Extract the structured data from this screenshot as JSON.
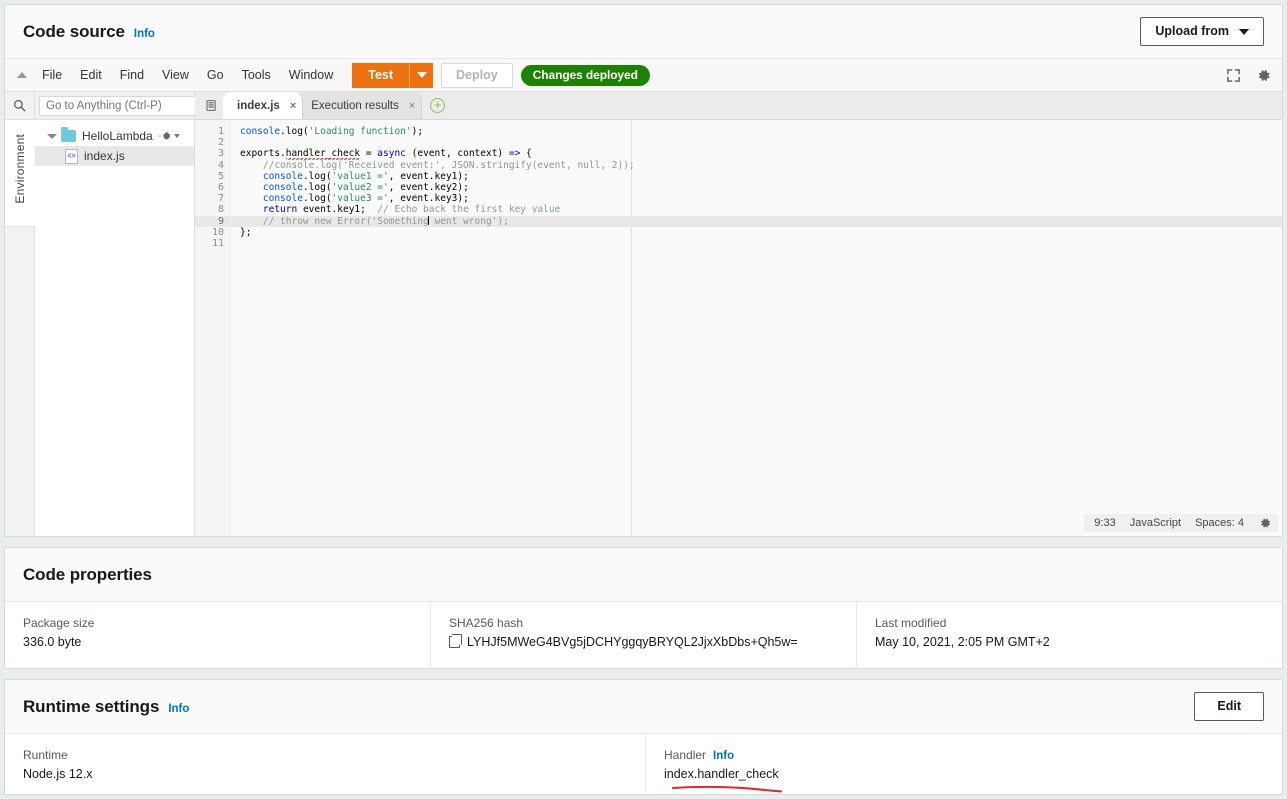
{
  "code_source": {
    "title": "Code source",
    "info_label": "Info",
    "upload_button": "Upload from"
  },
  "ide": {
    "menu": [
      "File",
      "Edit",
      "Find",
      "View",
      "Go",
      "Tools",
      "Window"
    ],
    "test_button": "Test",
    "deploy_button": "Deploy",
    "deployed_badge": "Changes deployed",
    "goto_placeholder": "Go to Anything (Ctrl-P)",
    "environment_label": "Environment",
    "tree": {
      "folder_name": "HelloLambda",
      "folder_path": "- /",
      "file_name": "index.js"
    },
    "tabs": [
      {
        "label": "index.js",
        "close": "×",
        "active": true
      },
      {
        "label": "Execution results",
        "close": "×",
        "active": false
      }
    ],
    "add_tab": "+",
    "status": {
      "cursor": "9:33",
      "language": "JavaScript",
      "indent": "Spaces: 4"
    },
    "line_numbers": [
      "1",
      "2",
      "3",
      "4",
      "5",
      "6",
      "7",
      "8",
      "9",
      "10",
      "11"
    ],
    "current_line": 9,
    "code_lines": [
      [
        {
          "t": "console",
          "c": "tok-fn"
        },
        {
          "t": ".log(",
          "c": ""
        },
        {
          "t": "'Loading function'",
          "c": "tok-str"
        },
        {
          "t": ");",
          "c": ""
        }
      ],
      [],
      [
        {
          "t": "exports.",
          "c": ""
        },
        {
          "t": "handler_check",
          "c": "squig"
        },
        {
          "t": " = ",
          "c": ""
        },
        {
          "t": "async",
          "c": "tok-kw"
        },
        {
          "t": " (event, context) ",
          "c": ""
        },
        {
          "t": "=>",
          "c": "tok-kw"
        },
        {
          "t": " {",
          "c": ""
        }
      ],
      [
        {
          "t": "    //console.log('Received event:', JSON.stringify(event, null, 2));",
          "c": "tok-com"
        }
      ],
      [
        {
          "t": "    ",
          "c": ""
        },
        {
          "t": "console",
          "c": "tok-fn"
        },
        {
          "t": ".log(",
          "c": ""
        },
        {
          "t": "'value1 ='",
          "c": "tok-str"
        },
        {
          "t": ", event.key1);",
          "c": ""
        }
      ],
      [
        {
          "t": "    ",
          "c": ""
        },
        {
          "t": "console",
          "c": "tok-fn"
        },
        {
          "t": ".log(",
          "c": ""
        },
        {
          "t": "'value2 ='",
          "c": "tok-str"
        },
        {
          "t": ", event.key2);",
          "c": ""
        }
      ],
      [
        {
          "t": "    ",
          "c": ""
        },
        {
          "t": "console",
          "c": "tok-fn"
        },
        {
          "t": ".log(",
          "c": ""
        },
        {
          "t": "'value3 ='",
          "c": "tok-str"
        },
        {
          "t": ", event.key3);",
          "c": ""
        }
      ],
      [
        {
          "t": "    ",
          "c": ""
        },
        {
          "t": "return",
          "c": "tok-kw"
        },
        {
          "t": " event.key1;  ",
          "c": ""
        },
        {
          "t": "// Echo back the first key value",
          "c": "tok-com"
        }
      ],
      [
        {
          "t": "    ",
          "c": ""
        },
        {
          "t": "// throw new Error('Something",
          "c": "tok-com"
        },
        {
          "t": "|CARET|",
          "c": ""
        },
        {
          "t": " went wrong');",
          "c": "tok-com"
        }
      ],
      [
        {
          "t": "};",
          "c": ""
        }
      ],
      []
    ],
    "code_plain": [
      "console.log('Loading function');",
      "",
      "exports.handler_check = async (event, context) => {",
      "    //console.log('Received event:', JSON.stringify(event, null, 2));",
      "    console.log('value1 =', event.key1);",
      "    console.log('value2 =', event.key2);",
      "    console.log('value3 =', event.key3);",
      "    return event.key1;  // Echo back the first key value",
      "    // throw new Error('Something went wrong');",
      "};",
      ""
    ]
  },
  "code_properties": {
    "title": "Code properties",
    "fields": [
      {
        "label": "Package size",
        "value": "336.0 byte"
      },
      {
        "label": "SHA256 hash",
        "value": "LYHJf5MWeG4BVg5jDCHYggqyBRYQL2JjxXbDbs+Qh5w="
      },
      {
        "label": "Last modified",
        "value": "May 10, 2021, 2:05 PM GMT+2"
      }
    ]
  },
  "runtime_settings": {
    "title": "Runtime settings",
    "info_label": "Info",
    "edit_button": "Edit",
    "runtime_label": "Runtime",
    "runtime_value": "Node.js 12.x",
    "handler_label": "Handler",
    "handler_info_label": "Info",
    "handler_value": "index.handler_check"
  },
  "colors": {
    "accent_orange": "#ec7211",
    "link_blue": "#0073bb",
    "success_green": "#1d8102",
    "annotation_red": "#e32b2b",
    "page_bg": "#eaeded"
  }
}
